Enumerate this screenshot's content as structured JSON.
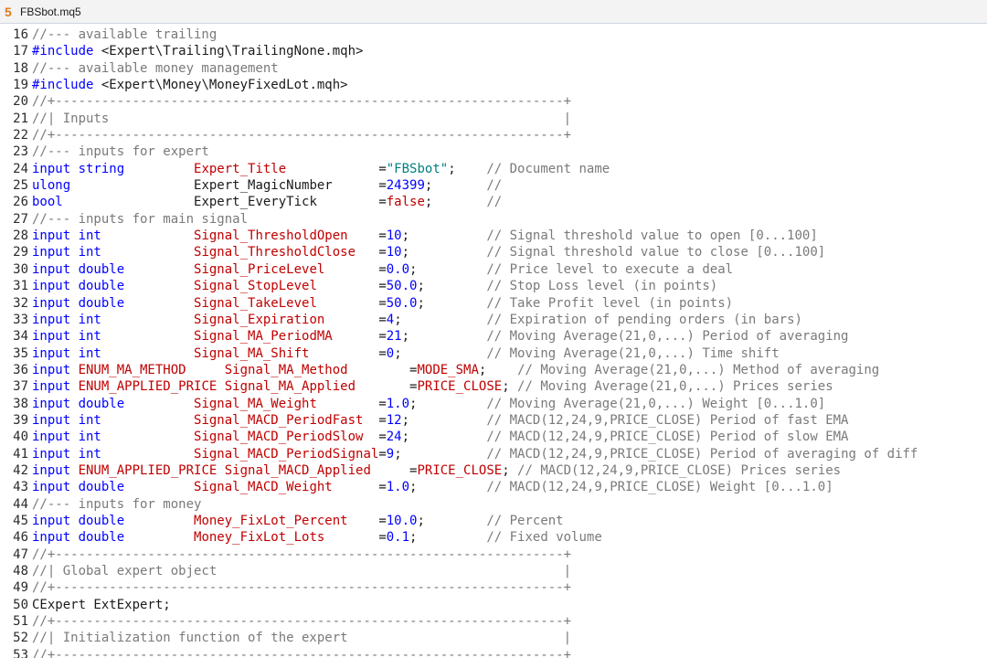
{
  "window": {
    "tab_title": "FBSbot.mq5",
    "file_icon_glyph": "5"
  },
  "lines": [
    {
      "n": "16",
      "segs": [
        [
          "cm",
          "//--- available trailing"
        ]
      ]
    },
    {
      "n": "17",
      "segs": [
        [
          "kw",
          "#include"
        ],
        [
          "inc",
          " <Expert\\Trailing\\TrailingNone.mqh>"
        ]
      ]
    },
    {
      "n": "18",
      "segs": [
        [
          "cm",
          "//--- available money management"
        ]
      ]
    },
    {
      "n": "19",
      "segs": [
        [
          "kw",
          "#include"
        ],
        [
          "inc",
          " <Expert\\Money\\MoneyFixedLot.mqh>"
        ]
      ]
    },
    {
      "n": "20",
      "segs": [
        [
          "cm",
          "//+------------------------------------------------------------------+"
        ]
      ]
    },
    {
      "n": "21",
      "segs": [
        [
          "cm",
          "//| Inputs                                                           |"
        ]
      ]
    },
    {
      "n": "22",
      "segs": [
        [
          "cm",
          "//+------------------------------------------------------------------+"
        ]
      ]
    },
    {
      "n": "23",
      "segs": [
        [
          "cm",
          "//--- inputs for expert"
        ]
      ]
    },
    {
      "n": "24",
      "segs": [
        [
          "kw",
          "input string         "
        ],
        [
          "var-red",
          "Expert_Title            "
        ],
        [
          "plain",
          "="
        ],
        [
          "str",
          "\"FBSbot\""
        ],
        [
          "plain",
          ";    "
        ],
        [
          "cm",
          "// Document name"
        ]
      ]
    },
    {
      "n": "25",
      "segs": [
        [
          "kw",
          "ulong                "
        ],
        [
          "var-blk",
          "Expert_MagicNumber      "
        ],
        [
          "plain",
          "="
        ],
        [
          "num",
          "24399"
        ],
        [
          "plain",
          ";       "
        ],
        [
          "cm",
          "//"
        ]
      ]
    },
    {
      "n": "26",
      "segs": [
        [
          "kw",
          "bool                 "
        ],
        [
          "var-blk",
          "Expert_EveryTick        "
        ],
        [
          "plain",
          "="
        ],
        [
          "var-red",
          "false"
        ],
        [
          "plain",
          ";       "
        ],
        [
          "cm",
          "//"
        ]
      ]
    },
    {
      "n": "27",
      "segs": [
        [
          "cm",
          "//--- inputs for main signal"
        ]
      ]
    },
    {
      "n": "28",
      "segs": [
        [
          "kw",
          "input int            "
        ],
        [
          "var-red",
          "Signal_ThresholdOpen    "
        ],
        [
          "plain",
          "="
        ],
        [
          "num",
          "10"
        ],
        [
          "plain",
          ";          "
        ],
        [
          "cm",
          "// Signal threshold value to open [0...100]"
        ]
      ]
    },
    {
      "n": "29",
      "segs": [
        [
          "kw",
          "input int            "
        ],
        [
          "var-red",
          "Signal_ThresholdClose   "
        ],
        [
          "plain",
          "="
        ],
        [
          "num",
          "10"
        ],
        [
          "plain",
          ";          "
        ],
        [
          "cm",
          "// Signal threshold value to close [0...100]"
        ]
      ]
    },
    {
      "n": "30",
      "segs": [
        [
          "kw",
          "input double         "
        ],
        [
          "var-red",
          "Signal_PriceLevel       "
        ],
        [
          "plain",
          "="
        ],
        [
          "num",
          "0.0"
        ],
        [
          "plain",
          ";         "
        ],
        [
          "cm",
          "// Price level to execute a deal"
        ]
      ]
    },
    {
      "n": "31",
      "segs": [
        [
          "kw",
          "input double         "
        ],
        [
          "var-red",
          "Signal_StopLevel        "
        ],
        [
          "plain",
          "="
        ],
        [
          "num",
          "50.0"
        ],
        [
          "plain",
          ";        "
        ],
        [
          "cm",
          "// Stop Loss level (in points)"
        ]
      ]
    },
    {
      "n": "32",
      "segs": [
        [
          "kw",
          "input double         "
        ],
        [
          "var-red",
          "Signal_TakeLevel        "
        ],
        [
          "plain",
          "="
        ],
        [
          "num",
          "50.0"
        ],
        [
          "plain",
          ";        "
        ],
        [
          "cm",
          "// Take Profit level (in points)"
        ]
      ]
    },
    {
      "n": "33",
      "segs": [
        [
          "kw",
          "input int            "
        ],
        [
          "var-red",
          "Signal_Expiration       "
        ],
        [
          "plain",
          "="
        ],
        [
          "num",
          "4"
        ],
        [
          "plain",
          ";           "
        ],
        [
          "cm",
          "// Expiration of pending orders (in bars)"
        ]
      ]
    },
    {
      "n": "34",
      "segs": [
        [
          "kw",
          "input int            "
        ],
        [
          "var-red",
          "Signal_MA_PeriodMA      "
        ],
        [
          "plain",
          "="
        ],
        [
          "num",
          "21"
        ],
        [
          "plain",
          ";          "
        ],
        [
          "cm",
          "// Moving Average(21,0,...) Period of averaging"
        ]
      ]
    },
    {
      "n": "35",
      "segs": [
        [
          "kw",
          "input int            "
        ],
        [
          "var-red",
          "Signal_MA_Shift         "
        ],
        [
          "plain",
          "="
        ],
        [
          "num",
          "0"
        ],
        [
          "plain",
          ";           "
        ],
        [
          "cm",
          "// Moving Average(21,0,...) Time shift"
        ]
      ]
    },
    {
      "n": "36",
      "segs": [
        [
          "kw",
          "input "
        ],
        [
          "enum",
          "ENUM_MA_METHOD   "
        ],
        [
          "plain",
          "  "
        ],
        [
          "var-red",
          "Signal_MA_Method        "
        ],
        [
          "plain",
          "="
        ],
        [
          "var-red",
          "MODE_SMA"
        ],
        [
          "plain",
          ";    "
        ],
        [
          "cm",
          "// Moving Average(21,0,...) Method of averaging"
        ]
      ]
    },
    {
      "n": "37",
      "segs": [
        [
          "kw",
          "input "
        ],
        [
          "enum",
          "ENUM_APPLIED_PRICE"
        ],
        [
          "plain",
          " "
        ],
        [
          "var-red",
          "Signal_MA_Applied       "
        ],
        [
          "plain",
          "="
        ],
        [
          "var-red",
          "PRICE_CLOSE"
        ],
        [
          "plain",
          "; "
        ],
        [
          "cm",
          "// Moving Average(21,0,...) Prices series"
        ]
      ]
    },
    {
      "n": "38",
      "segs": [
        [
          "kw",
          "input double         "
        ],
        [
          "var-red",
          "Signal_MA_Weight        "
        ],
        [
          "plain",
          "="
        ],
        [
          "num",
          "1.0"
        ],
        [
          "plain",
          ";         "
        ],
        [
          "cm",
          "// Moving Average(21,0,...) Weight [0...1.0]"
        ]
      ]
    },
    {
      "n": "39",
      "segs": [
        [
          "kw",
          "input int            "
        ],
        [
          "var-red",
          "Signal_MACD_PeriodFast  "
        ],
        [
          "plain",
          "="
        ],
        [
          "num",
          "12"
        ],
        [
          "plain",
          ";          "
        ],
        [
          "cm",
          "// MACD(12,24,9,PRICE_CLOSE) Period of fast EMA"
        ]
      ]
    },
    {
      "n": "40",
      "segs": [
        [
          "kw",
          "input int            "
        ],
        [
          "var-red",
          "Signal_MACD_PeriodSlow  "
        ],
        [
          "plain",
          "="
        ],
        [
          "num",
          "24"
        ],
        [
          "plain",
          ";          "
        ],
        [
          "cm",
          "// MACD(12,24,9,PRICE_CLOSE) Period of slow EMA"
        ]
      ]
    },
    {
      "n": "41",
      "segs": [
        [
          "kw",
          "input int            "
        ],
        [
          "var-red",
          "Signal_MACD_PeriodSignal"
        ],
        [
          "plain",
          "="
        ],
        [
          "num",
          "9"
        ],
        [
          "plain",
          ";           "
        ],
        [
          "cm",
          "// MACD(12,24,9,PRICE_CLOSE) Period of averaging of diff"
        ]
      ]
    },
    {
      "n": "42",
      "segs": [
        [
          "kw",
          "input "
        ],
        [
          "enum",
          "ENUM_APPLIED_PRICE"
        ],
        [
          "plain",
          " "
        ],
        [
          "var-red",
          "Signal_MACD_Applied     "
        ],
        [
          "plain",
          "="
        ],
        [
          "var-red",
          "PRICE_CLOSE"
        ],
        [
          "plain",
          "; "
        ],
        [
          "cm",
          "// MACD(12,24,9,PRICE_CLOSE) Prices series"
        ]
      ]
    },
    {
      "n": "43",
      "segs": [
        [
          "kw",
          "input double         "
        ],
        [
          "var-red",
          "Signal_MACD_Weight      "
        ],
        [
          "plain",
          "="
        ],
        [
          "num",
          "1.0"
        ],
        [
          "plain",
          ";         "
        ],
        [
          "cm",
          "// MACD(12,24,9,PRICE_CLOSE) Weight [0...1.0]"
        ]
      ]
    },
    {
      "n": "44",
      "segs": [
        [
          "cm",
          "//--- inputs for money"
        ]
      ]
    },
    {
      "n": "45",
      "segs": [
        [
          "kw",
          "input double         "
        ],
        [
          "var-red",
          "Money_FixLot_Percent    "
        ],
        [
          "plain",
          "="
        ],
        [
          "num",
          "10.0"
        ],
        [
          "plain",
          ";        "
        ],
        [
          "cm",
          "// Percent"
        ]
      ]
    },
    {
      "n": "46",
      "segs": [
        [
          "kw",
          "input double         "
        ],
        [
          "var-red",
          "Money_FixLot_Lots       "
        ],
        [
          "plain",
          "="
        ],
        [
          "num",
          "0.1"
        ],
        [
          "plain",
          ";         "
        ],
        [
          "cm",
          "// Fixed volume"
        ]
      ]
    },
    {
      "n": "47",
      "segs": [
        [
          "cm",
          "//+------------------------------------------------------------------+"
        ]
      ]
    },
    {
      "n": "48",
      "segs": [
        [
          "cm",
          "//| Global expert object                                             |"
        ]
      ]
    },
    {
      "n": "49",
      "segs": [
        [
          "cm",
          "//+------------------------------------------------------------------+"
        ]
      ]
    },
    {
      "n": "50",
      "segs": [
        [
          "plain",
          "CExpert ExtExpert;"
        ]
      ]
    },
    {
      "n": "51",
      "segs": [
        [
          "cm",
          "//+------------------------------------------------------------------+"
        ]
      ]
    },
    {
      "n": "52",
      "segs": [
        [
          "cm",
          "//| Initialization function of the expert                            |"
        ]
      ]
    },
    {
      "n": "53",
      "segs": [
        [
          "cm",
          "//+------------------------------------------------------------------+"
        ]
      ]
    }
  ]
}
